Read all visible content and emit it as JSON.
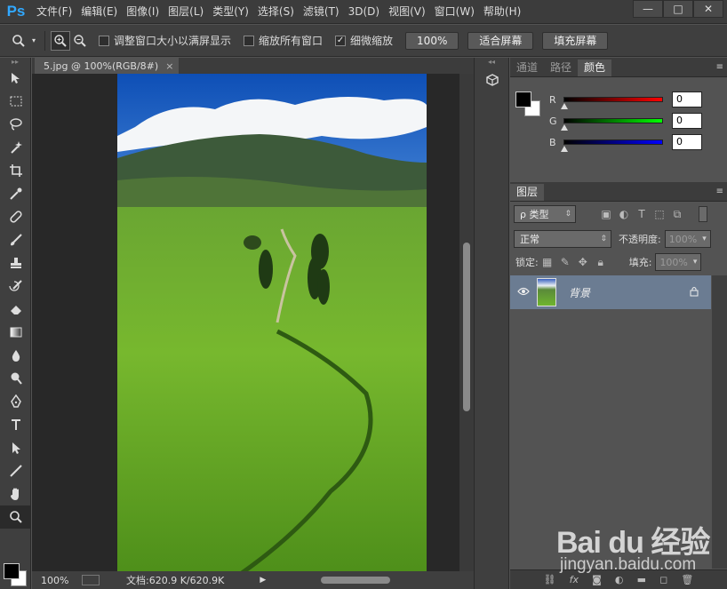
{
  "app": {
    "logo": "Ps",
    "menu": [
      "文件(F)",
      "编辑(E)",
      "图像(I)",
      "图层(L)",
      "类型(Y)",
      "选择(S)",
      "滤镜(T)",
      "3D(D)",
      "视图(V)",
      "窗口(W)",
      "帮助(H)"
    ],
    "window_controls": {
      "minimize": "—",
      "maximize": "□",
      "close": "✕"
    }
  },
  "options_bar": {
    "resize_windows_label": "调整窗口大小以满屏显示",
    "zoom_all_label": "缩放所有窗口",
    "scrubby_zoom_label": "细微缩放",
    "scrubby_zoom_checked": "✓",
    "btn_100": "100%",
    "btn_fit": "适合屏幕",
    "btn_fill": "填充屏幕"
  },
  "document": {
    "tab_title": "5.jpg @ 100%(RGB/8#)",
    "tab_close": "×",
    "zoom": "100%",
    "doc_info": "文档:620.9 K/620.9K"
  },
  "color_panel": {
    "tabs": [
      "通道",
      "路径",
      "颜色"
    ],
    "active_tab": "颜色",
    "sliders": [
      {
        "label": "R",
        "value": "0",
        "color": "#ff0000"
      },
      {
        "label": "G",
        "value": "0",
        "color": "#00ff00"
      },
      {
        "label": "B",
        "value": "0",
        "color": "#0000ff"
      }
    ]
  },
  "layers_panel": {
    "tab": "图层",
    "filter_type": "ρ 类型",
    "blend_mode": "正常",
    "opacity_label": "不透明度:",
    "opacity_value": "100%",
    "lock_label": "锁定:",
    "fill_label": "填充:",
    "fill_value": "100%",
    "layers": [
      {
        "name": "背景",
        "visible": true,
        "locked": true
      }
    ],
    "bottom_fx": "fx"
  },
  "watermark": {
    "brand": "Bai du 经验",
    "url": "jingyan.baidu.com"
  }
}
